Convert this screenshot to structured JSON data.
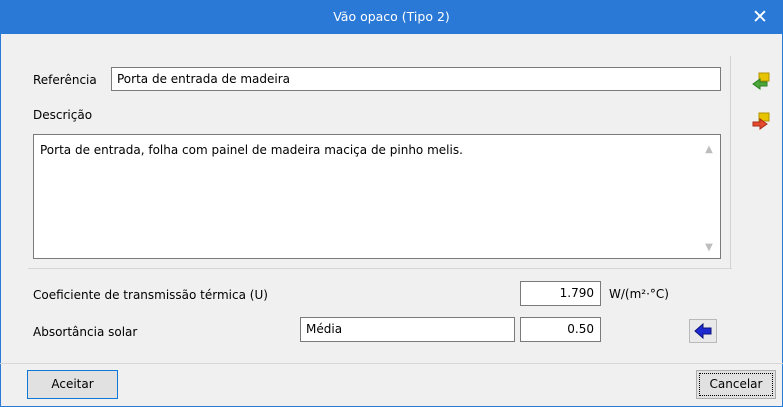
{
  "window": {
    "title": "Vão opaco (Tipo 2)",
    "close_glyph": "✕",
    "title_bar_color": "#2a79d6"
  },
  "form": {
    "referencia_label": "Referência",
    "referencia_value": "Porta de entrada de madeira",
    "descricao_label": "Descrição",
    "descricao_value": "Porta de entrada, folha com painel de madeira maciça de pinho melis.",
    "coef_label": "Coeficiente de transmissão térmica (U)",
    "coef_value": "1.790",
    "coef_unit": "W/(m²·°C)",
    "absort_label": "Absortância solar",
    "absort_option": "Média",
    "absort_value": "0.50"
  },
  "side_icons": [
    {
      "name": "import-icon",
      "color": "#e8c400"
    },
    {
      "name": "export-icon",
      "color": "#e8c400"
    }
  ],
  "buttons": {
    "accept": "Aceitar",
    "cancel": "Cancelar"
  }
}
